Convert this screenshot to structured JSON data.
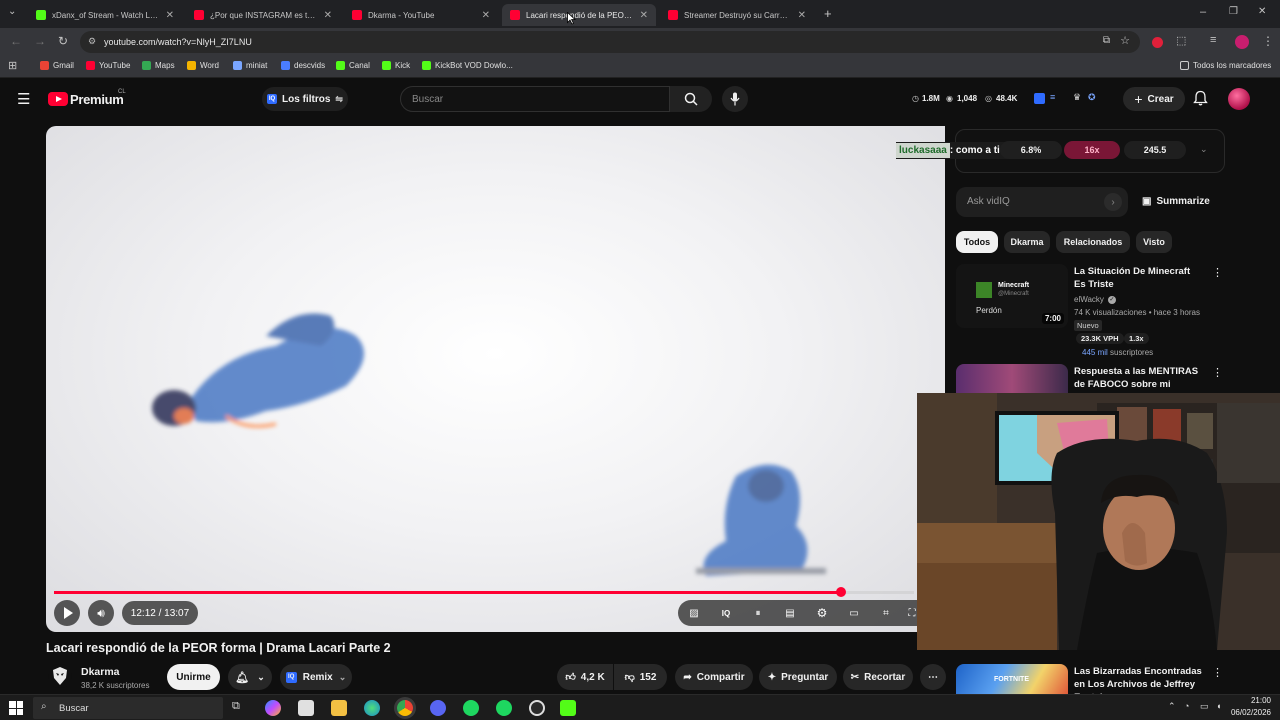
{
  "browser": {
    "tabs": [
      {
        "title": "xDanx_of Stream - Watch Live o",
        "color": "#53fc18",
        "active": false
      },
      {
        "title": "¿Por que INSTAGRAM es tan RA",
        "color": "#ff0033",
        "active": false
      },
      {
        "title": "Dkarma - YouTube",
        "color": "#ff0033",
        "active": false
      },
      {
        "title": "Lacari respondió de la PEOR fo",
        "color": "#ff0033",
        "active": true
      },
      {
        "title": "Streamer Destruyó su Carrera e",
        "color": "#ff0033",
        "active": false
      }
    ],
    "url": "youtube.com/watch?v=NlyH_ZI7LNU",
    "bookmarks": [
      {
        "label": "Gmail",
        "color": "#ea4335"
      },
      {
        "label": "YouTube",
        "color": "#ff0033"
      },
      {
        "label": "Maps",
        "color": "#34a853"
      },
      {
        "label": "Word",
        "color": "#f4b400"
      },
      {
        "label": "miniat",
        "color": "#7aa6ff"
      },
      {
        "label": "descvids",
        "color": "#4a7dff"
      },
      {
        "label": "Canal",
        "color": "#53fc18"
      },
      {
        "label": "Kick",
        "color": "#53fc18"
      },
      {
        "label": "KickBot VOD Dowlo...",
        "color": "#53fc18"
      }
    ],
    "all_bookmarks": "Todos los marcadores"
  },
  "yt": {
    "logo": "Premium",
    "region": "CL",
    "filters": "Los filtros",
    "search_placeholder": "Buscar",
    "stats": {
      "views": "1.8M",
      "likes": "1,048",
      "watching": "48.4K"
    },
    "create": "Crear"
  },
  "overlay": {
    "chat_user": "luckasaaa",
    "chat_msg": ": como a ti ?",
    "metric1": "6.8%",
    "metric2": "16x",
    "metric3": "245.5"
  },
  "player": {
    "time": "12:12 / 13:07",
    "progress": 0.915
  },
  "video": {
    "title": "Lacari respondió de la PEOR forma | Drama Lacari Parte 2",
    "channel": "Dkarma",
    "subs": "38,2 K suscriptores",
    "join": "Unirme",
    "remix": "Remix",
    "likes": "4,2 K",
    "dislikes": "152",
    "share": "Compartir",
    "ask": "Preguntar",
    "clip": "Recortar"
  },
  "sidebar": {
    "ask_placeholder": "Ask vidIQ",
    "summarize": "Summarize",
    "chips": [
      "Todos",
      "Dkarma",
      "Relacionados",
      "Visto"
    ],
    "rec1": {
      "title": "La Situación De Minecraft Es Triste",
      "channel": "elWacky",
      "meta": "74 K visualizaciones • hace 3 horas",
      "badge": "Nuevo",
      "vph": "23.3K VPH",
      "mult": "1.3x",
      "subs_count": "445 mil",
      "subs_label": " suscriptores",
      "duration": "7:00",
      "thumb_name": "Minecraft",
      "thumb_handle": "@Minecraft",
      "thumb_text": "Perdón"
    },
    "rec2": {
      "title": "Respuesta a las MENTIRAS de FABOCO sobre mi"
    },
    "rec3": {
      "title": "Las Bizarradas Encontradas en Los Archivos de Jeffrey Epstein",
      "thumb_text": "FORTNITE"
    }
  },
  "taskbar": {
    "search": "Buscar",
    "time": "21:00",
    "date": "06/02/2026"
  }
}
